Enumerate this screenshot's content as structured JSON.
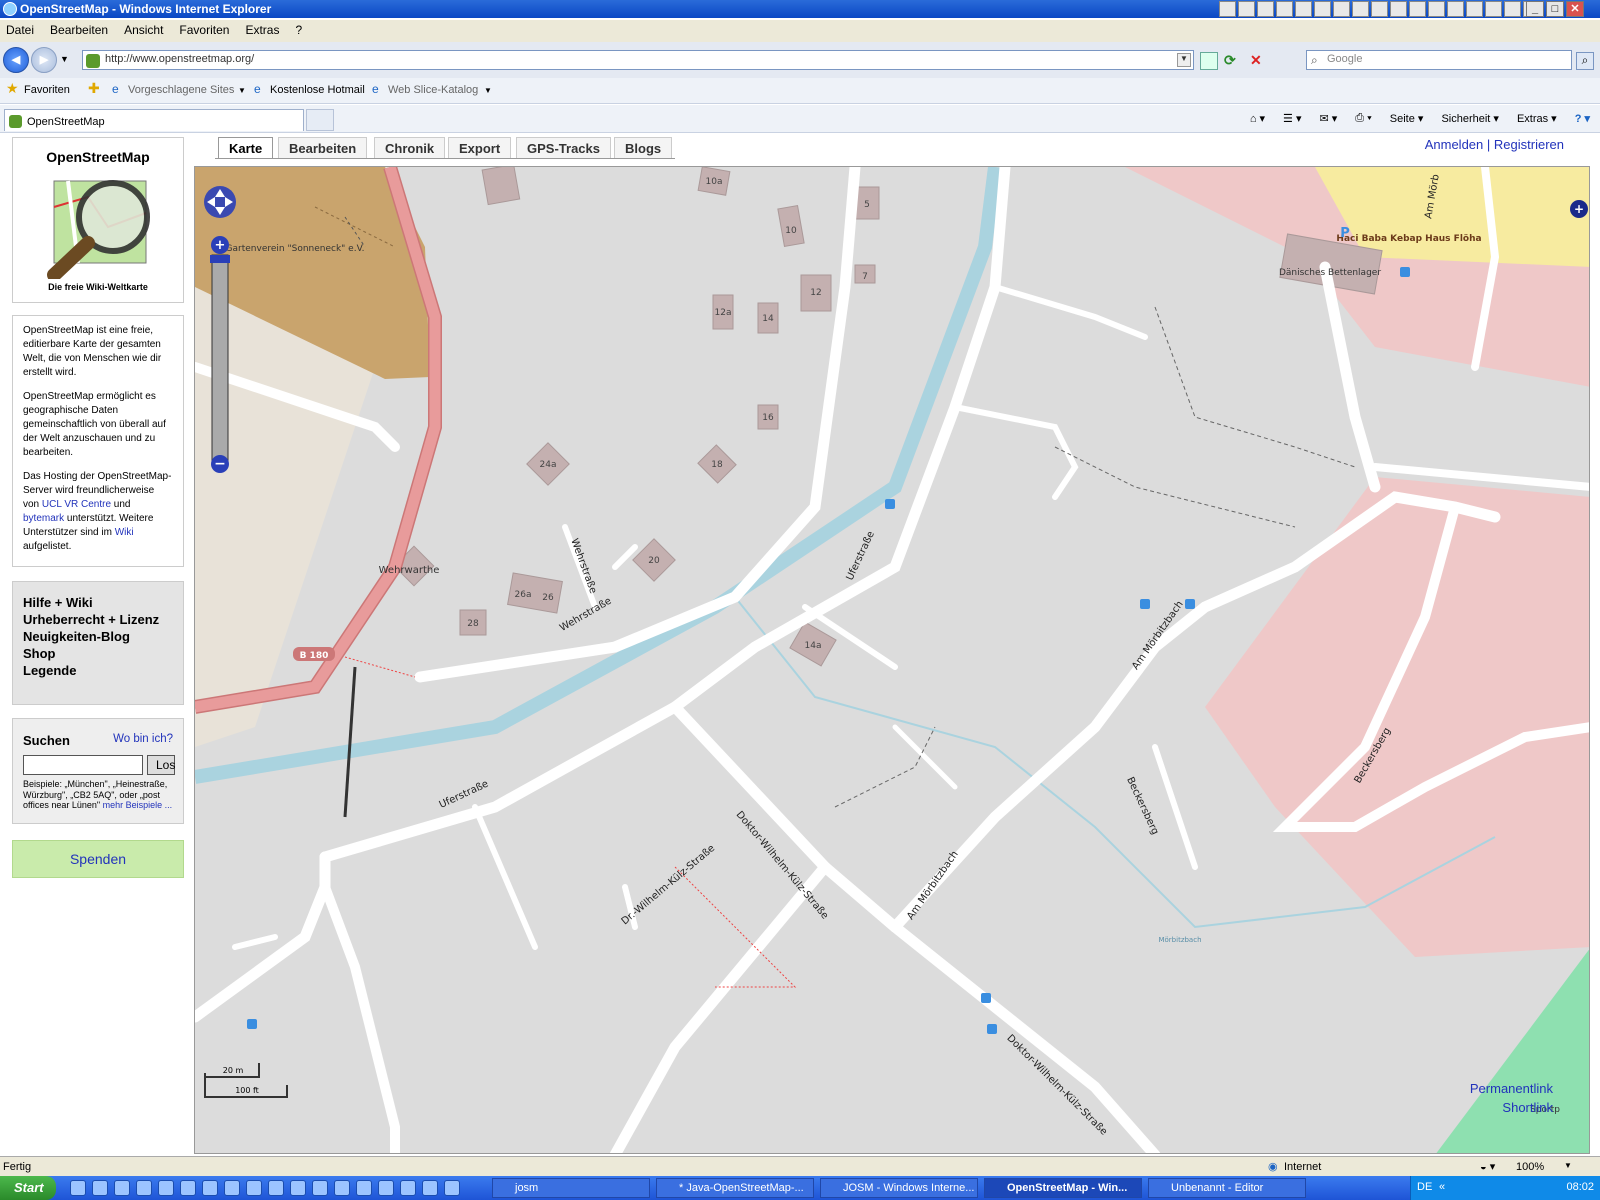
{
  "window": {
    "title": "OpenStreetMap - Windows Internet Explorer"
  },
  "menu": [
    "Datei",
    "Bearbeiten",
    "Ansicht",
    "Favoriten",
    "Extras",
    "?"
  ],
  "address": {
    "url": "http://www.openstreetmap.org/",
    "search_placeholder": "Google"
  },
  "favorites": {
    "label": "Favoriten",
    "items": [
      "Vorgeschlagene Sites",
      "Kostenlose Hotmail",
      "Web Slice-Katalog"
    ]
  },
  "tab": {
    "title": "OpenStreetMap"
  },
  "commands": [
    "Seite",
    "Sicherheit",
    "Extras"
  ],
  "sidebar": {
    "logo_title": "OpenStreetMap",
    "logo_subtitle": "Die freie Wiki-Weltkarte",
    "intro_p1": "OpenStreetMap ist eine freie, editierbare Karte der gesamten Welt, die von Menschen wie dir erstellt wird.",
    "intro_p2": "OpenStreetMap ermöglicht es geographische Daten gemeinschaftlich von überall auf der Welt anzuschauen und zu bearbeiten.",
    "intro_p3_a": "Das Hosting der OpenStreetMap-Server wird freundlicherweise von ",
    "intro_link_ucl": "UCL VR Centre",
    "intro_p3_b": " und ",
    "intro_link_bytemark": "bytemark",
    "intro_p3_c": " unterstützt. Weitere Unterstützer sind im ",
    "intro_link_wiki": "Wiki",
    "intro_p3_d": " aufgelistet.",
    "links": [
      "Hilfe + Wiki",
      "Urheberrecht + Lizenz",
      "Neuigkeiten-Blog",
      "Shop",
      "Legende"
    ],
    "search_title": "Suchen",
    "where_am_i": "Wo bin ich?",
    "search_button": "Los",
    "search_examples": "Beispiele: „München\", „Heinestraße, Würzburg\", „CB2 5AQ\", oder „post offices near Lünen\"",
    "more_examples": "mehr Beispiele ...",
    "donate": "Spenden"
  },
  "map_tabs": [
    "Karte",
    "Bearbeiten",
    "Chronik",
    "Export",
    "GPS-Tracks",
    "Blogs"
  ],
  "account": {
    "login": "Anmelden",
    "separator": "|",
    "register": "Registrieren"
  },
  "map": {
    "labels": {
      "garden": "Gartenverein \"Sonneneck\" e.V.",
      "wehrwarthe": "Wehrwarthe",
      "b180": "B 180",
      "wehrstrasse_1": "Wehrstraße",
      "wehrstrasse_2": "Wehrstraße",
      "uferstrasse_1": "Uferstraße",
      "uferstrasse_2": "Uferstraße",
      "kuelz_1": "Doktor-Wilhelm-Külz-Straße",
      "kuelz_2": "Dr.-Wilhelm-Külz-Straße",
      "kuelz_3": "Doktor-Wilhelm-Külz-Straße",
      "am_moerbitzbach_1": "Am Mörbitzbach",
      "am_moerbitzbach_2": "Am Mörbitzbach",
      "am_moerb_top": "Am Mörb",
      "beckersberg_1": "Beckersberg",
      "beckersberg_2": "Beckersberg",
      "moerbitzbach": "Mörbitzbach",
      "bettenlager": "Dänisches Bettenlager",
      "kebap": "Haci Baba Kebap Haus Flöha",
      "sport": "Sportp",
      "parking": "P"
    },
    "house_numbers": [
      "10a",
      "5",
      "10",
      "7",
      "12",
      "12a",
      "14",
      "16",
      "18",
      "24a",
      "20",
      "26a",
      "26",
      "28",
      "14a"
    ],
    "scale": {
      "metric": "20 m",
      "imperial": "100 ft"
    },
    "permalink": "Permanentlink",
    "shortlink": "Shortlink"
  },
  "status": {
    "text": "Fertig",
    "zone": "Internet",
    "zoom": "100%"
  },
  "taskbar": {
    "start": "Start",
    "tasks": [
      "josm",
      "* Java-OpenStreetMap-...",
      "JOSM - Windows Interne...",
      "OpenStreetMap - Win...",
      "Unbenannt - Editor"
    ],
    "lang": "DE",
    "clock": "08:02"
  },
  "colors": {
    "accent_link": "#2233bb",
    "donate_bg": "#c9ebab",
    "road": "#ffffff",
    "primary_road": "#e89b9b",
    "river": "#aad3df",
    "residential": "#dcdcdc",
    "retail": "#efc8c8",
    "allotments": "#c9a46d"
  }
}
